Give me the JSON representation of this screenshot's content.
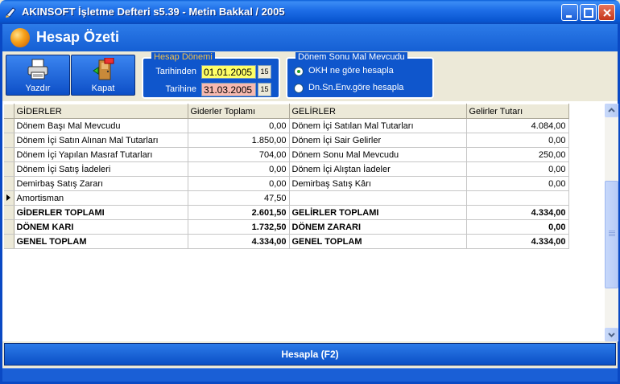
{
  "window": {
    "title": "AKINSOFT İşletme Defteri s5.39 - Metin Bakkal / 2005"
  },
  "header": {
    "title": "Hesap Özeti"
  },
  "toolbar": {
    "print_label": "Yazdır",
    "close_label": "Kapat"
  },
  "period": {
    "legend": "Hesap Dönemi",
    "from_label": "Tarihinden",
    "from_value": "01.01.2005",
    "to_label": "Tarihine",
    "to_value": "31.03.2005",
    "cal_glyph": "15"
  },
  "stock": {
    "legend": "Dönem Sonu Mal Mevcudu",
    "options": [
      {
        "label": "OKH ne göre hesapla",
        "selected": true
      },
      {
        "label": "Dn.Sn.Env.göre hesapla",
        "selected": false
      }
    ]
  },
  "grid": {
    "columns": [
      "GİDERLER",
      "Giderler Toplamı",
      "GELİRLER",
      "Gelirler Tutarı"
    ],
    "rows": [
      [
        "Dönem Başı Mal Mevcudu",
        "0,00",
        "Dönem İçi Satılan Mal Tutarları",
        "4.084,00"
      ],
      [
        "Dönem İçi Satın Alınan Mal Tutarları",
        "1.850,00",
        "Dönem İçi Sair Gelirler",
        "0,00"
      ],
      [
        "Dönem İçi Yapılan Masraf Tutarları",
        "704,00",
        "Dönem Sonu Mal Mevcudu",
        "250,00"
      ],
      [
        "Dönem İçi Satış İadeleri",
        "0,00",
        "Dönem İçi Alıştan İadeler",
        "0,00"
      ],
      [
        "Demirbaş Satış Zararı",
        "0,00",
        "Demirbaş Satış Kârı",
        "0,00"
      ],
      [
        "Amortisman",
        "47,50",
        "",
        ""
      ],
      [
        "GİDERLER TOPLAMI",
        "2.601,50",
        "GELİRLER TOPLAMI",
        "4.334,00"
      ],
      [
        "DÖNEM KARI",
        "1.732,50",
        "DÖNEM ZARARI",
        "0,00"
      ],
      [
        "GENEL TOPLAM",
        "4.334,00",
        "GENEL TOPLAM",
        "4.334,00"
      ]
    ]
  },
  "action": {
    "calculate_label": "Hesapla (F2)"
  }
}
